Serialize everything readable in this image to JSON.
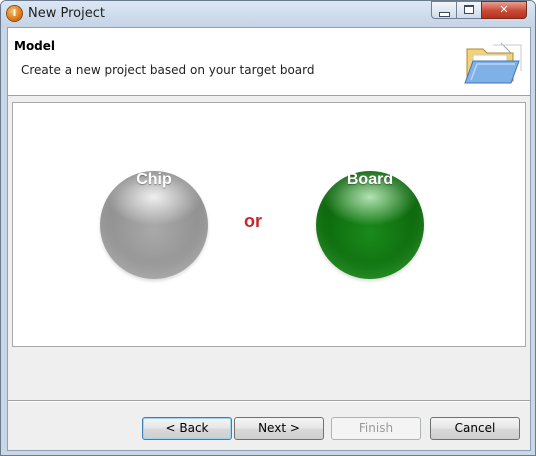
{
  "window": {
    "title": "New Project",
    "app_icon_glyph": "I",
    "minimize_icon": "minimize-icon",
    "maximize_icon": "maximize-icon",
    "close_glyph": "✕"
  },
  "header": {
    "title": "Model",
    "description": "Create a new project based on your target board",
    "icon": "open-folder-icon"
  },
  "choices": {
    "chip_label": "Chip",
    "separator": "or",
    "board_label": "Board",
    "chip_color": "#939393",
    "board_color": "#0e6b0e",
    "separator_color": "#c8262a"
  },
  "buttons": {
    "back": "< Back",
    "next": "Next >",
    "finish": "Finish",
    "cancel": "Cancel"
  }
}
